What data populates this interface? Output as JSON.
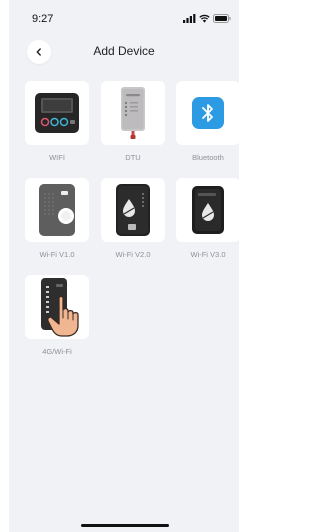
{
  "status_bar": {
    "time": "9:27",
    "icons": [
      "signal-icon",
      "wifi-icon",
      "battery-icon"
    ]
  },
  "header": {
    "title": "Add Device",
    "back_icon": "chevron-left-icon"
  },
  "devices": [
    {
      "label": "WIFI",
      "icon": "wifi-controller-device"
    },
    {
      "label": "DTU",
      "icon": "dtu-device"
    },
    {
      "label": "Bluetooth",
      "icon": "bluetooth-icon"
    },
    {
      "label": "Wi-Fi V1.0",
      "icon": "wifi-v1-device"
    },
    {
      "label": "Wi-Fi V2.0",
      "icon": "wifi-v2-device"
    },
    {
      "label": "Wi-Fi V3.0",
      "icon": "wifi-v3-device"
    },
    {
      "label": "4G/Wi-Fi",
      "icon": "4g-wifi-device"
    }
  ],
  "colors": {
    "background": "#f1f2f6",
    "tile": "#ffffff",
    "bluetooth_accent": "#2c9be4",
    "label_text": "#8e9097"
  }
}
